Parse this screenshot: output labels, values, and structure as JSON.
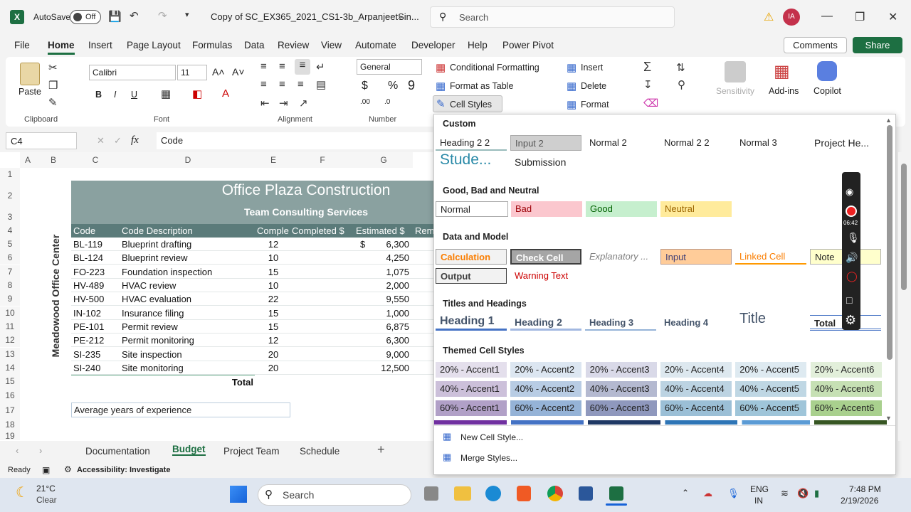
{
  "titlebar": {
    "autosave": "AutoSave",
    "toggle": "Off",
    "doc_title": "Copy of SC_EX365_2021_CS1-3b_ArpanjeetSin...",
    "search": "Search",
    "avatar": "IA"
  },
  "menu": {
    "items": [
      "File",
      "Home",
      "Insert",
      "Page Layout",
      "Formulas",
      "Data",
      "Review",
      "View",
      "Automate",
      "Developer",
      "Help",
      "Power Pivot"
    ],
    "comments": "Comments",
    "share": "Share"
  },
  "ribbon": {
    "paste": "Paste",
    "clipboard": "Clipboard",
    "font_name": "Calibri",
    "font_size": "11",
    "font": "Font",
    "alignment": "Alignment",
    "number_format": "General",
    "number": "Number",
    "cond_format": "Conditional Formatting",
    "format_table": "Format as Table",
    "cell_styles": "Cell Styles",
    "insert": "Insert",
    "delete": "Delete",
    "format": "Format",
    "sensitivity": "Sensitivity",
    "addins": "Add-ins",
    "copilot": "Copilot"
  },
  "formula": {
    "namebox": "C4",
    "fx": "fx",
    "content": "Code"
  },
  "columns": [
    "A",
    "B",
    "C",
    "D",
    "E",
    "F",
    "G"
  ],
  "rows": [
    "1",
    "2",
    "3",
    "4",
    "5",
    "6",
    "7",
    "8",
    "9",
    "10",
    "11",
    "12",
    "13",
    "14",
    "15",
    "16",
    "17",
    "18",
    "19"
  ],
  "sheet": {
    "title": "Office Plaza Construction",
    "subtitle": "Team Consulting Services",
    "side": "Meadowood Office Center",
    "headers": [
      "Code",
      "Code Description",
      "Comple",
      "Completed $",
      "Estimated $",
      "Rem"
    ],
    "data": [
      [
        "BL-119",
        "Blueprint drafting",
        "12",
        "$",
        "6,300"
      ],
      [
        "BL-124",
        "Blueprint review",
        "10",
        "",
        "4,250"
      ],
      [
        "FO-223",
        "Foundation inspection",
        "15",
        "",
        "1,075"
      ],
      [
        "HV-489",
        "HVAC review",
        "10",
        "",
        "2,000"
      ],
      [
        "HV-500",
        "HVAC evaluation",
        "22",
        "",
        "9,550"
      ],
      [
        "IN-102",
        "Insurance filing",
        "15",
        "",
        "1,000"
      ],
      [
        "PE-101",
        "Permit review",
        "15",
        "",
        "6,875"
      ],
      [
        "PE-212",
        "Permit monitoring",
        "12",
        "",
        "6,300"
      ],
      [
        "SI-235",
        "Site inspection",
        "20",
        "",
        "9,000"
      ],
      [
        "SI-240",
        "Site monitoring",
        "20",
        "",
        "12,500"
      ]
    ],
    "total": "Total",
    "avg": "Average years of experience"
  },
  "tabs": [
    "Documentation",
    "Budget",
    "Project Team",
    "Schedule"
  ],
  "status": {
    "ready": "Ready",
    "accessibility": "Accessibility: Investigate"
  },
  "panel": {
    "custom": {
      "title": "Custom",
      "items": [
        "Heading 2 2",
        "Input 2",
        "Normal 2",
        "Normal 2 2",
        "Normal 3",
        "Project He...",
        "Stude...",
        "Submission"
      ]
    },
    "good": {
      "title": "Good, Bad and Neutral",
      "items": [
        "Normal",
        "Bad",
        "Good",
        "Neutral"
      ]
    },
    "data_model": {
      "title": "Data and Model",
      "items": [
        "Calculation",
        "Check Cell",
        "Explanatory ...",
        "Input",
        "Linked Cell",
        "Note",
        "Output",
        "Warning Text"
      ]
    },
    "titles": {
      "title": "Titles and Headings",
      "items": [
        "Heading 1",
        "Heading 2",
        "Heading 3",
        "Heading 4",
        "Title",
        "Total"
      ]
    },
    "themed": {
      "title": "Themed Cell Styles",
      "row1": [
        "20% - Accent1",
        "20% - Accent2",
        "20% - Accent3",
        "20% - Accent4",
        "20% - Accent5",
        "20% - Accent6"
      ],
      "row2": [
        "40% - Accent1",
        "40% - Accent2",
        "40% - Accent3",
        "40% - Accent4",
        "40% - Accent5",
        "40% - Accent6"
      ],
      "row3": [
        "60% - Accent1",
        "60% - Accent2",
        "60% - Accent3",
        "60% - Accent4",
        "60% - Accent5",
        "60% - Accent6"
      ]
    },
    "new_style": "New Cell Style...",
    "merge": "Merge Styles..."
  },
  "recorder": {
    "time": "06:42"
  },
  "taskbar": {
    "temp": "21°C",
    "weather": "Clear",
    "search": "Search",
    "lang1": "ENG",
    "lang2": "IN",
    "time": "7:48 PM",
    "date": "2/19/2026"
  }
}
